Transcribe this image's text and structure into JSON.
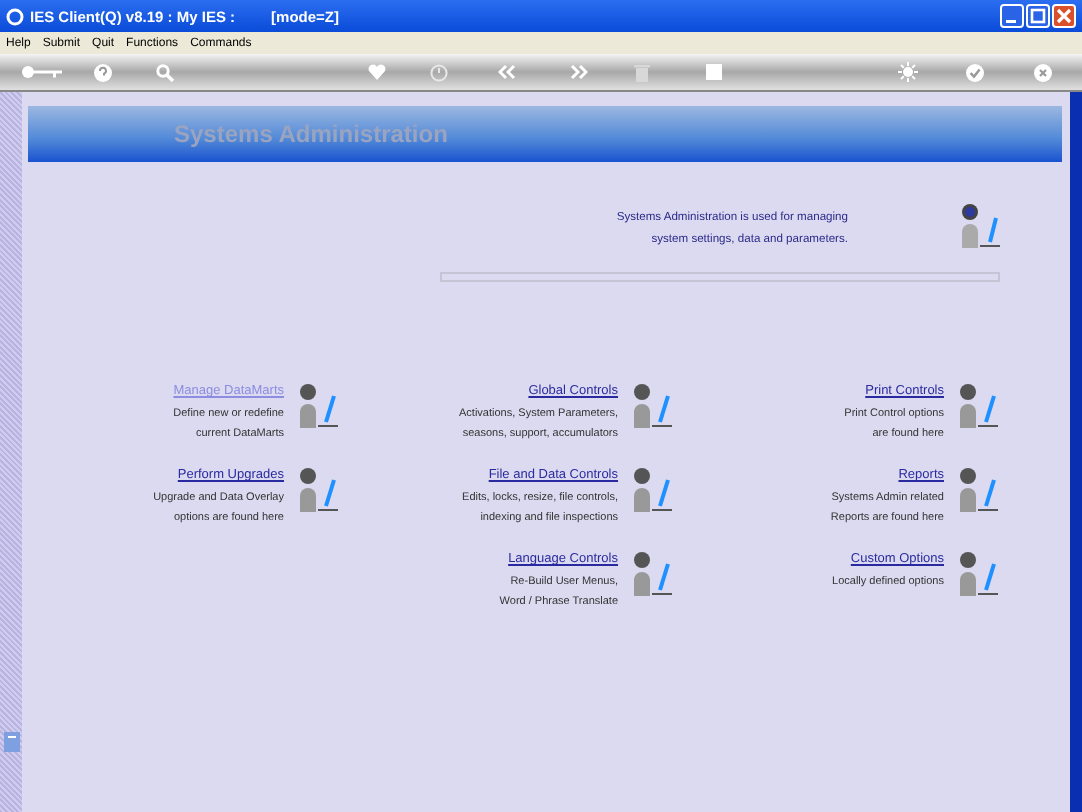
{
  "window": {
    "title": "IES Client(Q) v8.19 : My IES :",
    "mode": "[mode=Z]"
  },
  "menu": [
    "Help",
    "Submit",
    "Quit",
    "Functions",
    "Commands"
  ],
  "banner": {
    "title": "Systems Administration"
  },
  "intro": {
    "lines": [
      "Systems Administration is used for managing",
      "system settings, data and parameters."
    ]
  },
  "columns": [
    [
      {
        "title": "Manage DataMarts",
        "lines": [
          "Define new or redefine",
          "current DataMarts"
        ],
        "disabled": true
      },
      {
        "title": "Perform Upgrades",
        "lines": [
          "Upgrade and Data Overlay",
          "options are found here"
        ],
        "disabled": false
      }
    ],
    [
      {
        "title": "Global Controls",
        "lines": [
          "Activations, System Parameters,",
          "seasons, support, accumulators"
        ],
        "disabled": false
      },
      {
        "title": "File and Data Controls",
        "lines": [
          "Edits, locks, resize, file controls,",
          "indexing and file inspections"
        ],
        "disabled": false
      },
      {
        "title": "Language Controls",
        "lines": [
          "Re-Build User Menus,",
          "Word / Phrase Translate"
        ],
        "disabled": false
      }
    ],
    [
      {
        "title": "Print Controls",
        "lines": [
          "Print Control options",
          "are found here"
        ],
        "disabled": false
      },
      {
        "title": "Reports",
        "lines": [
          "Systems Admin related",
          "Reports are found here"
        ],
        "disabled": false
      },
      {
        "title": "Custom Options",
        "lines": [
          "Locally defined options"
        ],
        "disabled": false
      }
    ]
  ]
}
